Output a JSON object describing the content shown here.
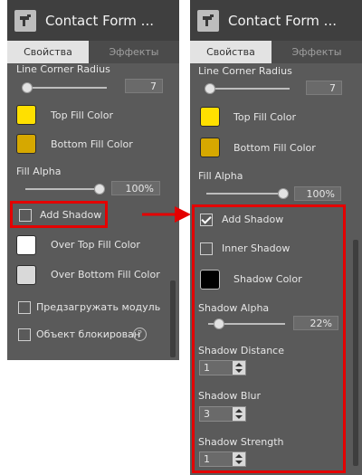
{
  "app_title": "Contact Form ...",
  "tabs": {
    "properties": "Свойства",
    "effects": "Эффекты"
  },
  "left": {
    "line_corner_radius": {
      "label": "Line Corner Radius",
      "value": "7"
    },
    "top_fill_color": {
      "label": "Top Fill Color",
      "color": "#ffe000"
    },
    "bottom_fill_color": {
      "label": "Bottom Fill Color",
      "color": "#d6a800"
    },
    "fill_alpha": {
      "label": "Fill Alpha",
      "value": "100%"
    },
    "add_shadow": {
      "label": "Add Shadow",
      "checked": false
    },
    "over_top_fill_color": {
      "label": "Over Top Fill Color",
      "color": "#ffffff"
    },
    "over_bottom_fill_color": {
      "label": "Over Bottom Fill Color",
      "color": "#d9d9d9"
    },
    "preload_module": {
      "label": "Предзагружать модуль",
      "checked": false
    },
    "object_locked": {
      "label": "Объект блокирован",
      "checked": false,
      "help": "?"
    }
  },
  "right": {
    "line_corner_radius": {
      "label": "Line Corner Radius",
      "value": "7"
    },
    "top_fill_color": {
      "label": "Top Fill Color",
      "color": "#ffe000"
    },
    "bottom_fill_color": {
      "label": "Bottom Fill Color",
      "color": "#d6a800"
    },
    "fill_alpha": {
      "label": "Fill Alpha",
      "value": "100%"
    },
    "add_shadow": {
      "label": "Add Shadow",
      "checked": true
    },
    "inner_shadow": {
      "label": "Inner Shadow",
      "checked": false
    },
    "shadow_color": {
      "label": "Shadow Color",
      "color": "#000000"
    },
    "shadow_alpha": {
      "label": "Shadow Alpha",
      "value": "22%"
    },
    "shadow_distance": {
      "label": "Shadow Distance",
      "value": "1"
    },
    "shadow_blur": {
      "label": "Shadow Blur",
      "value": "3"
    },
    "shadow_strength": {
      "label": "Shadow Strength",
      "value": "1"
    }
  },
  "colors": {
    "highlight": "#e40000",
    "panel_bg": "#5a5a5a",
    "titlebar_bg": "#3f3f3f"
  }
}
